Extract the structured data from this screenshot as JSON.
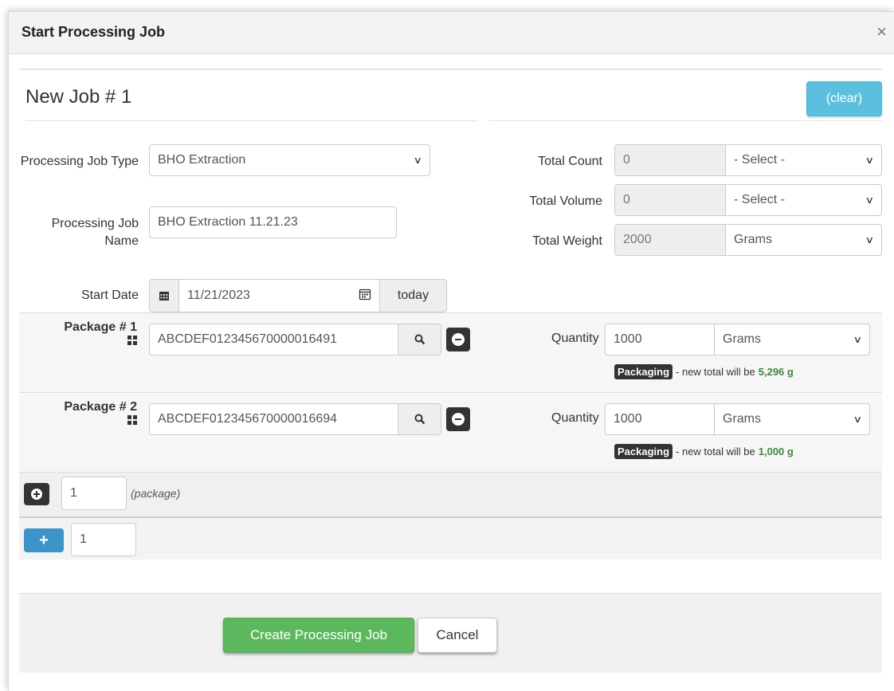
{
  "dialog": {
    "title": "Start Processing Job",
    "close_label": "×"
  },
  "job": {
    "title": "New Job # 1",
    "clear_label": "(clear)",
    "type_label": "Processing Job Type",
    "type_value": "BHO Extraction",
    "name_label": "Processing Job Name",
    "name_value": "BHO Extraction 11.21.23",
    "start_date_label": "Start Date",
    "start_date_value": "11/21/2023",
    "today_label": "today"
  },
  "totals": {
    "count_label": "Total Count",
    "count_value": "0",
    "count_unit": "- Select -",
    "volume_label": "Total Volume",
    "volume_value": "0",
    "volume_unit": "- Select -",
    "weight_label": "Total Weight",
    "weight_value": "2000",
    "weight_unit": "Grams"
  },
  "packages": [
    {
      "label": "Package # 1",
      "tag": "ABCDEF012345670000016491",
      "quantity_label": "Quantity",
      "quantity": "1000",
      "unit": "Grams",
      "badge": "Packaging",
      "note_prefix": "- new total will be",
      "note_total": "5,296 g"
    },
    {
      "label": "Package # 2",
      "tag": "ABCDEF012345670000016694",
      "quantity_label": "Quantity",
      "quantity": "1000",
      "unit": "Grams",
      "badge": "Packaging",
      "note_prefix": "- new total will be",
      "note_total": "1,000 g"
    }
  ],
  "add_package": {
    "count": "1",
    "note": "(package)"
  },
  "add_job": {
    "count": "1"
  },
  "footer": {
    "create_label": "Create Processing Job",
    "cancel_label": "Cancel"
  },
  "colors": {
    "clear": "#5bc0de",
    "create": "#5cb85c",
    "add_job": "#3b95c9",
    "total_green": "#3c8c3c"
  },
  "icons": [
    "close-icon",
    "chevron-down-icon",
    "calendar-icon",
    "calendar-picker-icon",
    "barcode-grid-icon",
    "search-icon",
    "minus-circle-icon",
    "plus-circle-icon",
    "plus-icon"
  ]
}
